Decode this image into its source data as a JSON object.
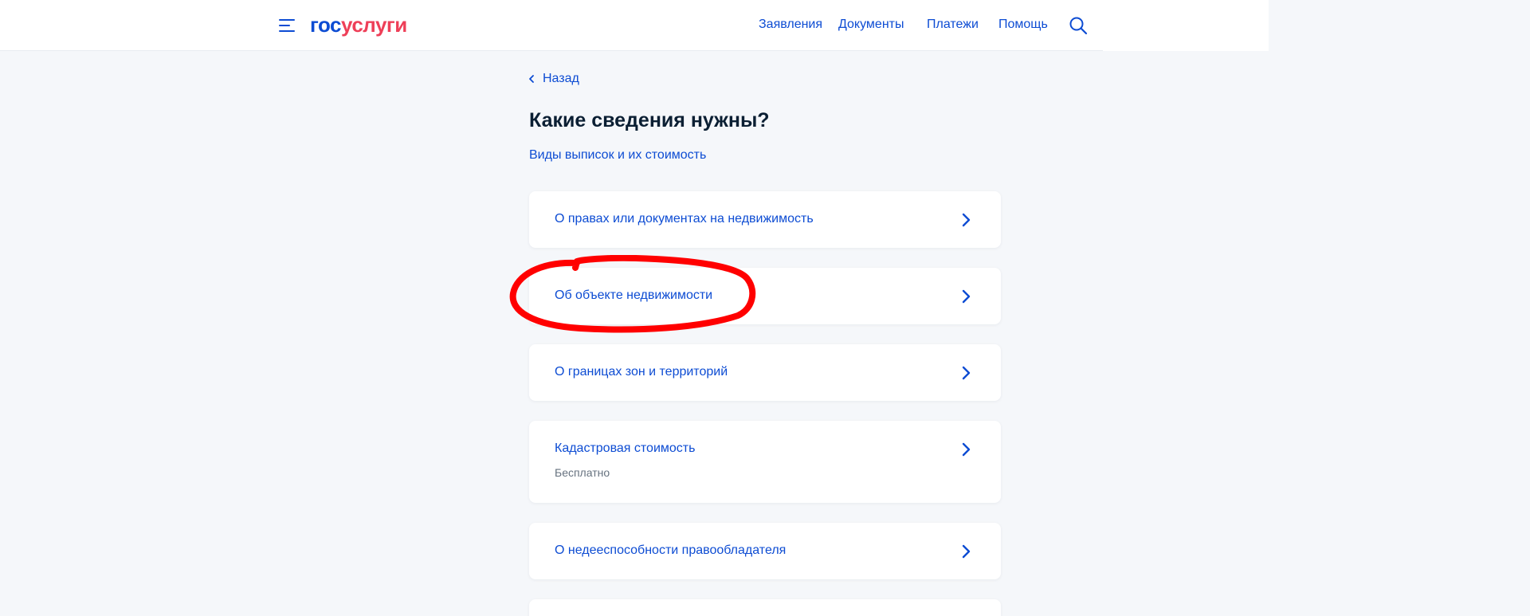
{
  "header": {
    "logo": {
      "part1": "гос",
      "part2": "услуги"
    },
    "nav": [
      "Заявления",
      "Документы",
      "Платежи",
      "Помощь"
    ],
    "colors": {
      "accent": "#0d4cd3",
      "brand_red": "#ee3f58",
      "text_dark": "#0b1f33",
      "background": "#f5f7fa"
    }
  },
  "main": {
    "back_label": "Назад",
    "title": "Какие сведения нужны?",
    "subtitle_link": "Виды выписок и их стоимость",
    "options": [
      {
        "label": "О правах или документах на недвижимость"
      },
      {
        "label": "Об объекте недвижимости",
        "highlighted": true
      },
      {
        "label": "О границах зон и территорий"
      },
      {
        "label": "Кадастровая стоимость",
        "note": "Бесплатно"
      },
      {
        "label": "О недееспособности правообладателя"
      }
    ]
  },
  "annotation": {
    "type": "red-hand-drawn-ellipse",
    "color": "#ff0000"
  },
  "icons": [
    "burger-menu-icon",
    "search-icon",
    "chevron-left-icon",
    "chevron-right-icon"
  ]
}
